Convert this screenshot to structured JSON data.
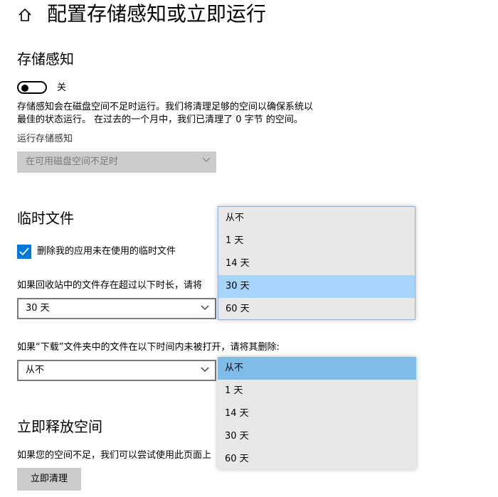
{
  "header": {
    "title": "配置存储感知或立即运行",
    "home_icon": "home-icon"
  },
  "storage_sense": {
    "heading": "存储感知",
    "toggle_state": "关",
    "toggle_on": false,
    "description_line1": "存储感知会在磁盘空间不足时运行。我们将清理足够的空间以确保系统以",
    "description_line2": "最佳的状态运行。 在过去的一个月中，我们已清理了 0 字节 的空间。",
    "run_label": "运行存储感知",
    "run_value": "在可用磁盘空间不足时"
  },
  "temp_files": {
    "heading": "临时文件",
    "checkbox_label": "删除我的应用未在使用的临时文件",
    "checkbox_checked": true,
    "recycle_label": "如果回收站中的文件存在超过以下时长，请将",
    "recycle_value": "30 天",
    "downloads_label": "如果“下载”文件夹中的文件在以下时间内未被打开，请将其删除:",
    "downloads_value": "从不"
  },
  "free_space": {
    "heading": "立即释放空间",
    "description": "如果您的空间不足，我们可以尝试使用此页面上",
    "button_label": "立即清理"
  },
  "recycle_dropdown": {
    "options": [
      "从不",
      "1 天",
      "14 天",
      "30 天",
      "60 天"
    ],
    "highlighted": "30 天"
  },
  "downloads_dropdown": {
    "options": [
      "从不",
      "1 天",
      "14 天",
      "30 天",
      "60 天"
    ],
    "selected": "从不"
  },
  "colors": {
    "accent": "#0078d7",
    "hover": "#a6d4fa",
    "selected": "#80bce8",
    "disabled_bg": "#cccccc"
  }
}
